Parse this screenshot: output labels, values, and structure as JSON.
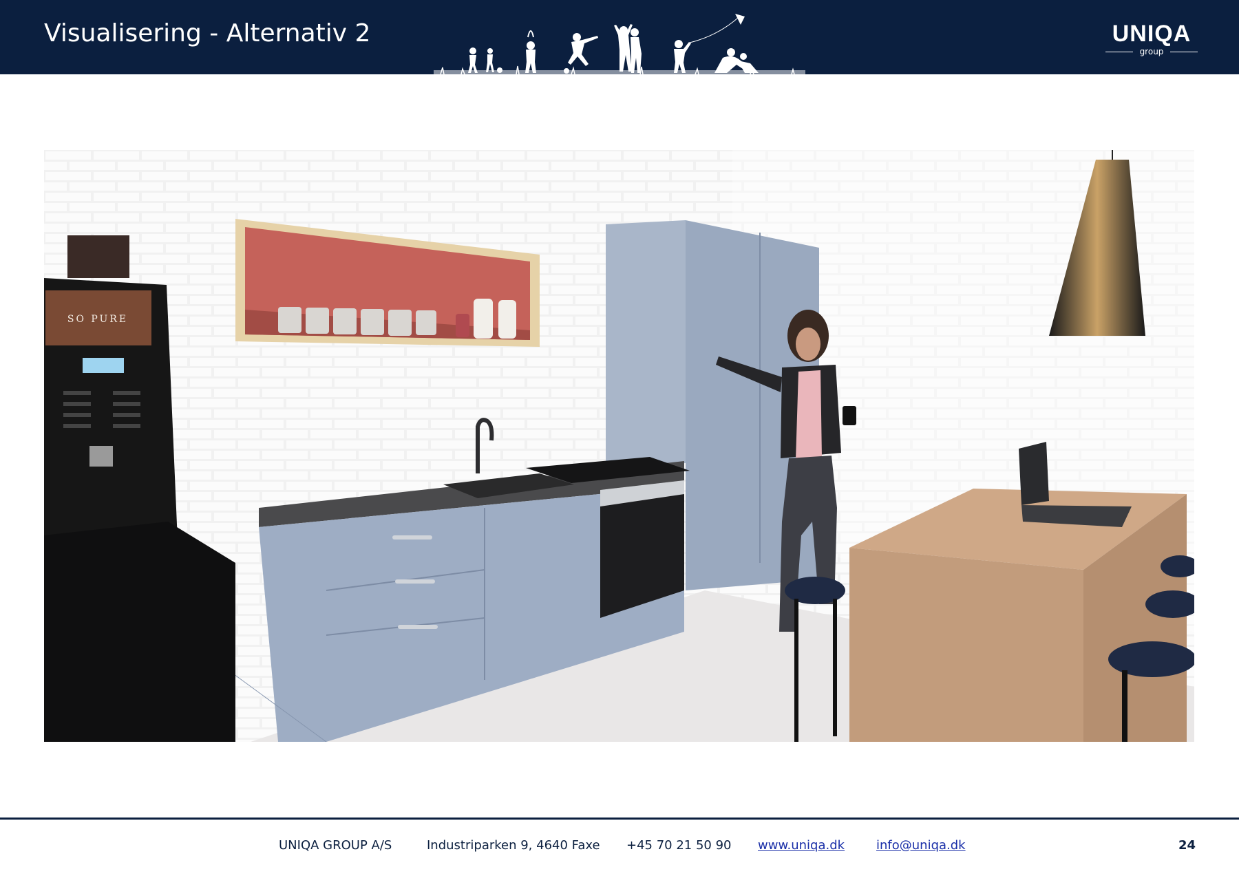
{
  "header": {
    "title": "Visualisering - Alternativ 2",
    "logo_word": "UNIQA",
    "logo_sub": "group",
    "background_color": "#0b1f3f",
    "decoration_icon": "children-silhouettes-icon"
  },
  "image": {
    "subject_icon": "kitchen-visualisation-image",
    "machine_brand": "SO PURE"
  },
  "footer": {
    "company": "UNIQA GROUP A/S",
    "address": "Industriparken 9, 4640 Faxe",
    "phone": "+45 70 21 50 90",
    "website": "www.uniqa.dk",
    "email": "info@uniqa.dk",
    "page_number": "24",
    "link_color": "#1a2fa8"
  }
}
